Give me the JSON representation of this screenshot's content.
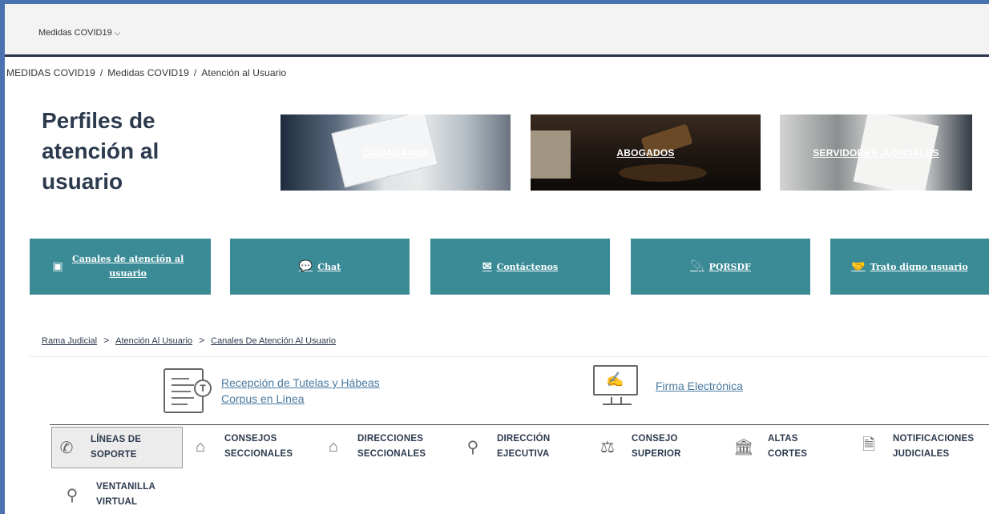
{
  "topbar": {
    "menu_label": "Medidas COVID19",
    "menu_icon": "chevron-down-icon"
  },
  "breadcrumb_top": [
    "MEDIDAS COVID19",
    "Medidas COVID19",
    "Atención al Usuario"
  ],
  "page_title": "Perfiles de atención al usuario",
  "profiles": [
    {
      "label": "CIUDADANOS"
    },
    {
      "label": "ABOGADOS"
    },
    {
      "label": "SERVIDORES JUDICIALES"
    }
  ],
  "action_buttons": [
    {
      "label": "Canales de atención al usuario",
      "icon": "presentation-icon"
    },
    {
      "label": "Chat",
      "icon": "chat-bubble-icon"
    },
    {
      "label": "Contáctenos",
      "icon": "envelope-icon"
    },
    {
      "label": "PQRSDF",
      "icon": "paperclip-icon"
    },
    {
      "label": "Trato digno usuario",
      "icon": "handshake-icon"
    }
  ],
  "breadcrumb_inner": [
    "Rama Judicial",
    "Atención Al Usuario",
    "Canales De Atención Al Usuario"
  ],
  "links": [
    {
      "line1": "Recepción de Tutelas y Hábeas",
      "line2": "Corpus en Línea",
      "icon": "document-t-icon"
    },
    {
      "label": "Firma Electrónica",
      "icon": "monitor-signature-icon"
    }
  ],
  "nav_items": [
    {
      "line1": "LÍNEAS DE",
      "line2": "SOPORTE",
      "icon": "phone-icon",
      "active": true
    },
    {
      "line1": "CONSEJOS",
      "line2": "SECCIONALES",
      "icon": "building-icon"
    },
    {
      "line1": "DIRECCIONES",
      "line2": "SECCIONALES",
      "icon": "house-icon"
    },
    {
      "line1": "DIRECCIÓN",
      "line2": "EJECUTIVA",
      "icon": "user-icon"
    },
    {
      "line1": "CONSEJO",
      "line2": "SUPERIOR",
      "icon": "scales-icon"
    },
    {
      "line1": "ALTAS",
      "line2": "CORTES",
      "icon": "courthouse-icon"
    },
    {
      "line1": "NOTIFICACIONES",
      "line2": "JUDICIALES",
      "icon": "notification-document-icon"
    },
    {
      "line1": "VENTANILLA",
      "line2": "VIRTUAL",
      "icon": "user-icon"
    }
  ]
}
